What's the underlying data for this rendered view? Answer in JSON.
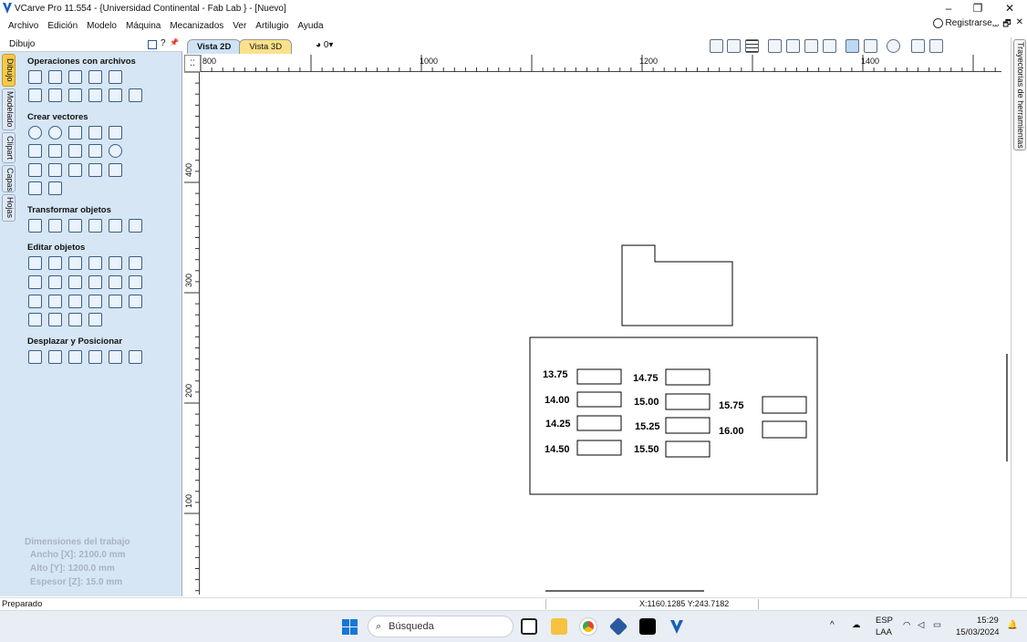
{
  "window": {
    "title": "VCarve Pro 11.554 - {Universidad Continental - Fab Lab } - [Nuevo]",
    "minimize": "–",
    "restore": "❐",
    "close": "✕"
  },
  "menu": [
    "Archivo",
    "Edición",
    "Modelo",
    "Máquina",
    "Mecanizados",
    "Ver",
    "Artilugio",
    "Ayuda"
  ],
  "signin": "Registrarse...",
  "mdi": [
    "_",
    "🗗",
    "✕"
  ],
  "panel": {
    "title": "Dibujo",
    "help": "?",
    "pin": "📌",
    "side_tabs": [
      "Dibujo",
      "Modelado",
      "Clipart",
      "Capas",
      "Hojas"
    ],
    "sections": [
      "Operaciones con archivos",
      "Crear vectores",
      "Transformar objetos",
      "Editar objetos",
      "Desplazar y Posicionar"
    ],
    "dims": {
      "heading": "Dimensiones del trabajo",
      "width": "Ancho   [X]: 2100.0 mm",
      "height": "Alto    [Y]: 1200.0 mm",
      "thickness": "Espesor [Z]: 15.0 mm"
    }
  },
  "view_tabs": [
    "Vista 2D",
    "Vista 3D"
  ],
  "layer": "0",
  "right_tab": "Trayectorias de herramientas",
  "ruler": {
    "corner": "⁚⁚",
    "h": [
      "800",
      "1000",
      "1200",
      "1400"
    ],
    "v": [
      "400",
      "300",
      "200",
      "100"
    ]
  },
  "canvas": {
    "labels": [
      "13.75",
      "14.00",
      "14.25",
      "14.50",
      "14.75",
      "15.00",
      "15.25",
      "15.50",
      "15.75",
      "16.00"
    ]
  },
  "status": {
    "text": "Preparado",
    "coords": "X:1160.1285 Y:243.7182"
  },
  "taskbar": {
    "search": "Búsqueda",
    "lang": "ESP",
    "region": "LAA",
    "time": "15:29",
    "date": "15/03/2024"
  }
}
